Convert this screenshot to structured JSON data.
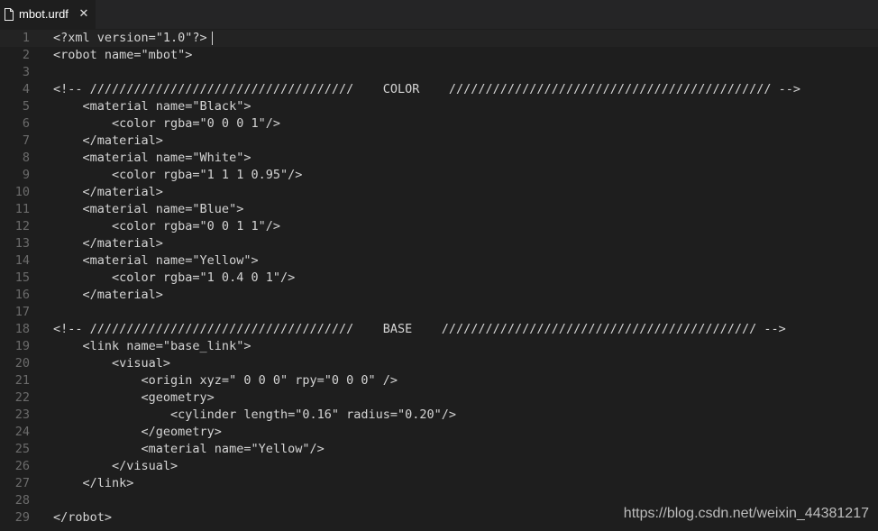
{
  "tab": {
    "title": "mbot.urdf",
    "icon": "file-icon",
    "close_glyph": "✕"
  },
  "editor": {
    "lines": [
      {
        "n": "1",
        "text": "<?xml version=\"1.0\"?>"
      },
      {
        "n": "2",
        "text": "<robot name=\"mbot\">"
      },
      {
        "n": "3",
        "text": ""
      },
      {
        "n": "4",
        "text": "<!-- ////////////////////////////////////    COLOR    //////////////////////////////////////////// -->"
      },
      {
        "n": "5",
        "text": "    <material name=\"Black\">"
      },
      {
        "n": "6",
        "text": "        <color rgba=\"0 0 0 1\"/>"
      },
      {
        "n": "7",
        "text": "    </material>"
      },
      {
        "n": "8",
        "text": "    <material name=\"White\">"
      },
      {
        "n": "9",
        "text": "        <color rgba=\"1 1 1 0.95\"/>"
      },
      {
        "n": "10",
        "text": "    </material>"
      },
      {
        "n": "11",
        "text": "    <material name=\"Blue\">"
      },
      {
        "n": "12",
        "text": "        <color rgba=\"0 0 1 1\"/>"
      },
      {
        "n": "13",
        "text": "    </material>"
      },
      {
        "n": "14",
        "text": "    <material name=\"Yellow\">"
      },
      {
        "n": "15",
        "text": "        <color rgba=\"1 0.4 0 1\"/>"
      },
      {
        "n": "16",
        "text": "    </material>"
      },
      {
        "n": "17",
        "text": ""
      },
      {
        "n": "18",
        "text": "<!-- ////////////////////////////////////    BASE    /////////////////////////////////////////// -->"
      },
      {
        "n": "19",
        "text": "    <link name=\"base_link\">"
      },
      {
        "n": "20",
        "text": "        <visual>"
      },
      {
        "n": "21",
        "text": "            <origin xyz=\" 0 0 0\" rpy=\"0 0 0\" />"
      },
      {
        "n": "22",
        "text": "            <geometry>"
      },
      {
        "n": "23",
        "text": "                <cylinder length=\"0.16\" radius=\"0.20\"/>"
      },
      {
        "n": "24",
        "text": "            </geometry>"
      },
      {
        "n": "25",
        "text": "            <material name=\"Yellow\"/>"
      },
      {
        "n": "26",
        "text": "        </visual>"
      },
      {
        "n": "27",
        "text": "    </link>"
      },
      {
        "n": "28",
        "text": ""
      },
      {
        "n": "29",
        "text": "</robot>"
      }
    ]
  },
  "watermark": "https://blog.csdn.net/weixin_44381217",
  "colors": {
    "background": "#1e1e1e",
    "tabbar": "#252526",
    "text": "#d4d4d4",
    "line_number": "#6b6b6b"
  }
}
